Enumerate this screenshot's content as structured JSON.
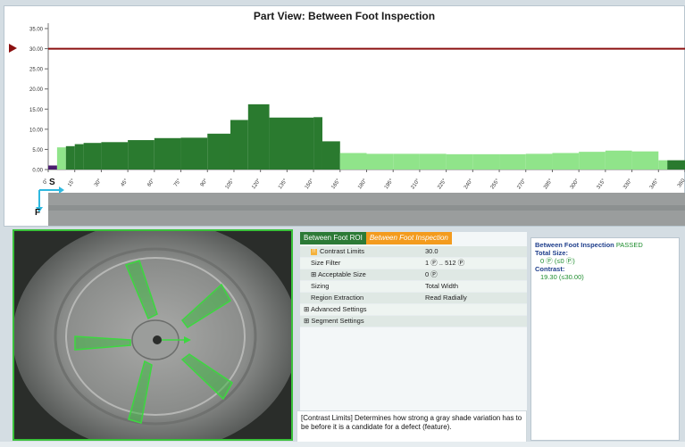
{
  "chart": {
    "title": "Part View:  Between Foot Inspection",
    "colors": {
      "dark": "#2a7a2f",
      "light": "#90e48a",
      "limit": "#8b1010",
      "marker": "#4a1d6e"
    }
  },
  "chart_data": {
    "type": "bar",
    "title": "Part View:  Between Foot Inspection",
    "ylim": [
      0,
      35
    ],
    "y_ticks": [
      "0.00",
      "5.00",
      "10.00",
      "15.00",
      "20.00",
      "25.00",
      "30.00",
      "35.00"
    ],
    "x_ticks": [
      "0°",
      "15°",
      "30°",
      "45°",
      "60°",
      "75°",
      "90°",
      "105°",
      "120°",
      "135°",
      "150°",
      "165°",
      "180°",
      "195°",
      "210°",
      "225°",
      "240°",
      "255°",
      "270°",
      "285°",
      "300°",
      "315°",
      "330°",
      "345°",
      "360"
    ],
    "limit": 30.0,
    "angles": [
      0,
      5,
      10,
      15,
      20,
      30,
      45,
      60,
      75,
      90,
      103,
      113,
      125,
      150,
      155,
      165,
      180,
      195,
      210,
      225,
      240,
      255,
      270,
      285,
      300,
      315,
      330,
      345,
      350
    ],
    "values": [
      1.0,
      5.5,
      5.8,
      6.3,
      6.6,
      6.8,
      7.3,
      7.8,
      7.9,
      8.9,
      12.3,
      16.2,
      12.9,
      13.0,
      7.0,
      4.1,
      3.9,
      3.9,
      3.9,
      3.8,
      3.8,
      3.8,
      3.9,
      4.1,
      4.4,
      4.7,
      4.5,
      2.3,
      2.3
    ],
    "category": [
      "marker",
      "light",
      "dark",
      "dark",
      "dark",
      "dark",
      "dark",
      "dark",
      "dark",
      "dark",
      "dark",
      "dark",
      "dark",
      "dark",
      "dark",
      "light",
      "light",
      "light",
      "light",
      "light",
      "light",
      "light",
      "light",
      "light",
      "light",
      "light",
      "light",
      "light",
      "dark"
    ]
  },
  "axis_labels": {
    "s": "S",
    "f": "F"
  },
  "tabs": {
    "roi": "Between Foot ROI",
    "inspection": "Between Foot Inspection"
  },
  "props": {
    "contrast_limits": {
      "name": "Contrast Limits",
      "value": "30.0"
    },
    "size_filter": {
      "name": "Size Filter",
      "value": "1 Ⓟ .. 512 Ⓟ"
    },
    "acceptable_size": {
      "name": "⊞ Acceptable Size",
      "value": "0 Ⓟ"
    },
    "sizing": {
      "name": "Sizing",
      "value": "Total Width"
    },
    "region_extraction": {
      "name": "Region Extraction",
      "value": "Read Radially"
    },
    "advanced": {
      "name": "⊞  Advanced Settings"
    },
    "segment": {
      "name": "⊞  Segment Settings"
    }
  },
  "description": "[Contrast Limits] Determines how strong a gray shade variation has to be before it is a candidate for a defect (feature).",
  "results": {
    "title": "Between Foot Inspection",
    "status": "PASSED",
    "total_size_label": "Total Size:",
    "total_size_value": "0 Ⓟ (≤0 Ⓟ)",
    "contrast_label": "Contrast:",
    "contrast_value": "19.30 (≤30.00)"
  }
}
